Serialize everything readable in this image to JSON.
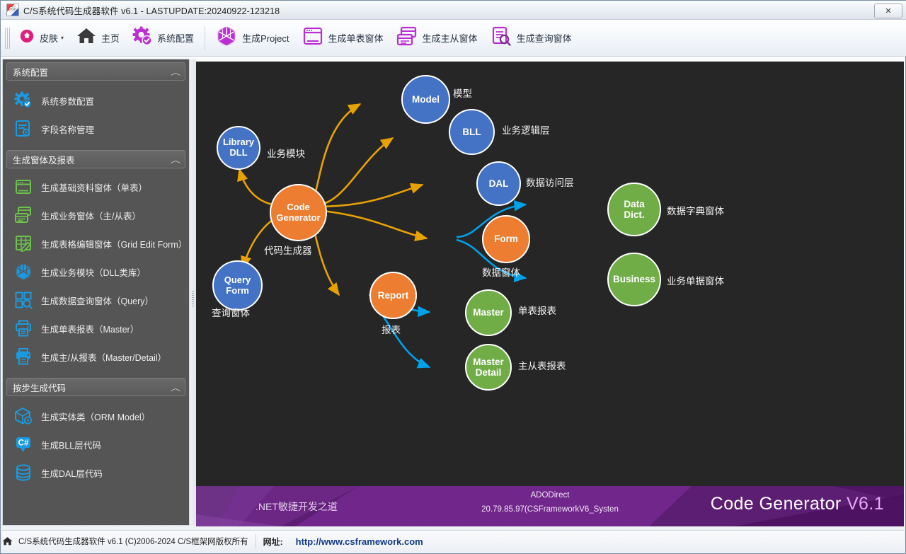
{
  "window": {
    "title": "C/S系统代码生成器软件 v6.1 - LASTUPDATE:20240922-123218",
    "logo_text": "CS",
    "close_label": "✕"
  },
  "toolbar": {
    "items": [
      {
        "label": "皮肤",
        "icon": "skin-icon",
        "caret": "▾"
      },
      {
        "label": "主页",
        "icon": "home-icon",
        "caret": ""
      },
      {
        "label": "系统配置",
        "icon": "gear-check-icon",
        "caret": ""
      },
      {
        "label": "生成Project",
        "icon": "cube-icon",
        "caret": ""
      },
      {
        "label": "生成单表窗体",
        "icon": "window-icon",
        "caret": ""
      },
      {
        "label": "生成主从窗体",
        "icon": "master-detail-window-icon",
        "caret": ""
      },
      {
        "label": "生成查询窗体",
        "icon": "query-window-icon",
        "caret": ""
      }
    ]
  },
  "sidebar": {
    "groups": [
      {
        "title": "系统配置",
        "chevron": "︿",
        "items": [
          {
            "label": "系统参数配置",
            "icon": "gear-check-icon",
            "color": "#1a9ae0"
          },
          {
            "label": "字段名称管理",
            "icon": "field-list-icon",
            "color": "#1a9ae0"
          }
        ]
      },
      {
        "title": "生成窗体及报表",
        "chevron": "︿",
        "items": [
          {
            "label": "生成基础资料窗体（单表）",
            "icon": "single-window-icon",
            "color": "#6cc24a"
          },
          {
            "label": "生成业务窗体（主/从表）",
            "icon": "master-detail-icon",
            "color": "#6cc24a"
          },
          {
            "label": "生成表格编辑窗体（Grid Edit Form）",
            "icon": "grid-edit-icon",
            "color": "#6cc24a"
          },
          {
            "label": "生成业务模块（DLL类库）",
            "icon": "cube-icon",
            "color": "#1a9ae0"
          },
          {
            "label": "生成数据查询窗体（Query）",
            "icon": "query-icon",
            "color": "#1a9ae0"
          },
          {
            "label": "生成单表报表（Master）",
            "icon": "printer-icon",
            "color": "#1a9ae0"
          },
          {
            "label": "生成主/从报表（Master/Detail）",
            "icon": "printer-detail-icon",
            "color": "#1a9ae0"
          }
        ]
      },
      {
        "title": "按步生成代码",
        "chevron": "︿",
        "items": [
          {
            "label": "生成实体类（ORM Model）",
            "icon": "box-model-icon",
            "color": "#1a9ae0"
          },
          {
            "label": "生成BLL层代码",
            "icon": "csharp-icon",
            "color": "#1a9ae0"
          },
          {
            "label": "生成DAL层代码",
            "icon": "database-icon",
            "color": "#1a9ae0"
          }
        ]
      }
    ]
  },
  "diagram": {
    "background": "#262626",
    "arrow_orange": "#e8a200",
    "arrow_blue": "#00a2e8",
    "nodes": [
      {
        "id": "library",
        "title1": "Library",
        "title2": "DLL",
        "color": "blue",
        "label": "业务模块"
      },
      {
        "id": "codegen",
        "title1": "Code",
        "title2": "Generator",
        "color": "orange",
        "label": "代码生成器"
      },
      {
        "id": "query",
        "title1": "Query",
        "title2": "Form",
        "color": "blue",
        "label": "查询窗体"
      },
      {
        "id": "model",
        "title1": "Model",
        "title2": "",
        "color": "blue",
        "label": "模型"
      },
      {
        "id": "bll",
        "title1": "BLL",
        "title2": "",
        "color": "blue",
        "label": "业务逻辑层"
      },
      {
        "id": "dal",
        "title1": "DAL",
        "title2": "",
        "color": "blue",
        "label": "数据访问层"
      },
      {
        "id": "form",
        "title1": "Form",
        "title2": "",
        "color": "orange",
        "label": "数据窗体"
      },
      {
        "id": "report",
        "title1": "Report",
        "title2": "",
        "color": "orange",
        "label": "报表"
      },
      {
        "id": "datadict",
        "title1": "Data",
        "title2": "Dict.",
        "color": "green",
        "label": "数据字典窗体"
      },
      {
        "id": "business",
        "title1": "Business",
        "title2": "",
        "color": "green",
        "label": "业务单据窗体"
      },
      {
        "id": "master",
        "title1": "Master",
        "title2": "",
        "color": "green",
        "label": "单表报表"
      },
      {
        "id": "masterdet",
        "title1": "Master",
        "title2": "Detail",
        "color": "green",
        "label": "主从表报表"
      }
    ]
  },
  "banner": {
    "left": ".NET敏捷开发之道",
    "center_line1": "ADODirect",
    "center_line2": "20.79.85.97(CSFrameworkV6_Systen",
    "right_title": "Code Generator ",
    "right_version": "V6.1"
  },
  "statusbar": {
    "copyright": "C/S系统代码生成器软件 v6.1 (C)2006-2024 C/S框架网版权所有",
    "url_label": "网址:",
    "url": "http://www.csframework.com",
    "home_icon": "home-icon"
  }
}
